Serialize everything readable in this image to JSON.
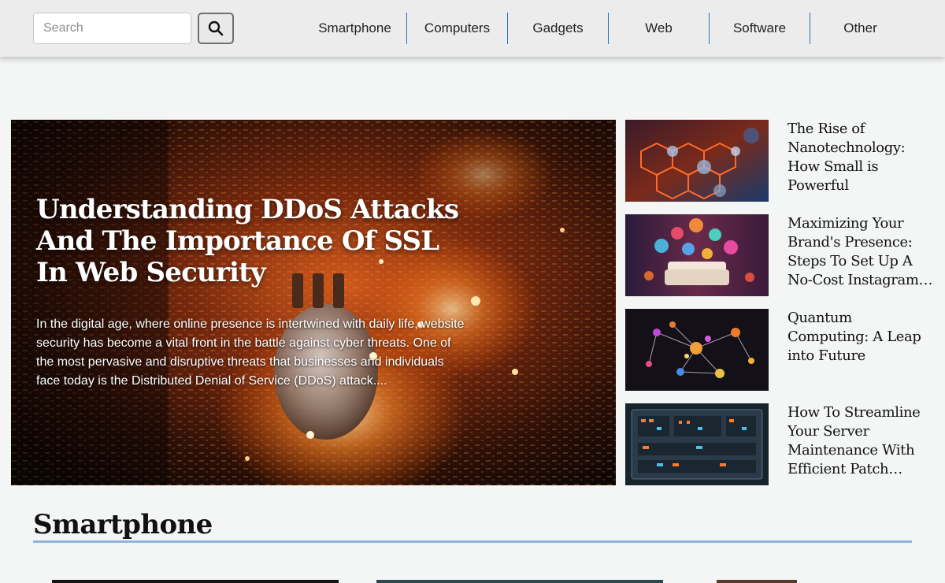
{
  "search": {
    "placeholder": "Search"
  },
  "nav": {
    "items": [
      "Smartphone",
      "Computers",
      "Gadgets",
      "Web",
      "Software",
      "Other"
    ]
  },
  "hero": {
    "title": "Understanding DDoS Attacks And The Importance Of SSL In Web Security",
    "excerpt": "In the digital age, where online presence is intertwined with daily life, website security has become a vital front in the battle against cyber threats. One of the most pervasive and disruptive threats that businesses and individuals face today is the Distributed Denial of Service (DDoS) attack...."
  },
  "side_articles": [
    {
      "title": "The Rise of Nanotechnology: How Small is Powerful"
    },
    {
      "title": "Maximizing Your Brand's Presence: Steps To Set Up A No-Cost Instagram Business Account"
    },
    {
      "title": "Quantum Computing: A Leap into Future"
    },
    {
      "title": "How To Streamline Your Server Maintenance With Efficient Patch Management"
    }
  ],
  "section": {
    "title": "Smartphone"
  },
  "colors": {
    "accent": "#2b73b8",
    "rule": "#8fb5dc",
    "header_bg": "#ececec",
    "page_bg": "#f4f5f5"
  }
}
